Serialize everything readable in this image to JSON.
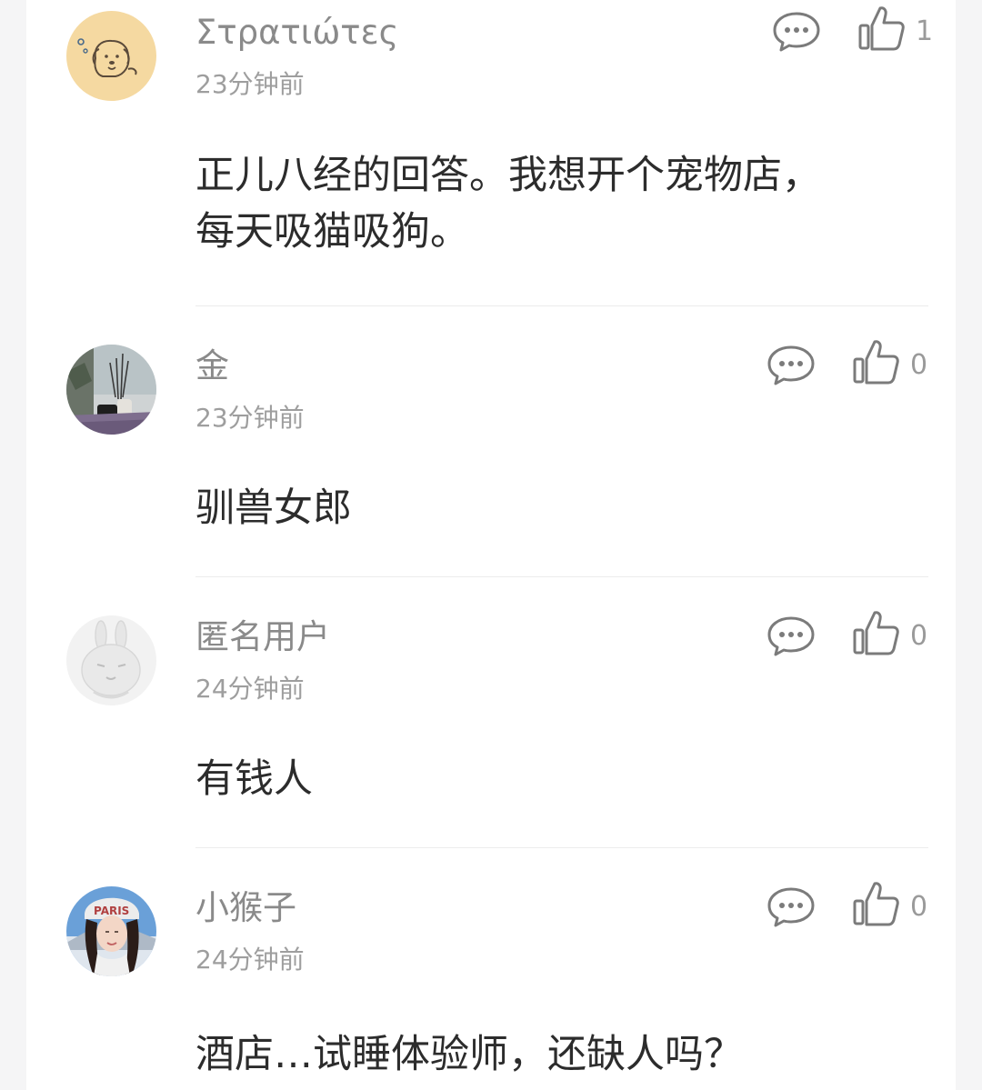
{
  "comments": [
    {
      "username": "Στρατιώτες",
      "time": "23分钟前",
      "likes": "1",
      "content_lines": [
        "正儿八经的回答。我想开个宠物店，",
        "每天吸猫吸狗。"
      ],
      "avatar_icon": "dog-cartoon-avatar"
    },
    {
      "username": "金",
      "time": "23分钟前",
      "likes": "0",
      "content_lines": [
        "驯兽女郎"
      ],
      "avatar_icon": "winter-window-photo-avatar"
    },
    {
      "username": "匿名用户",
      "time": "24分钟前",
      "likes": "0",
      "content_lines": [
        "有钱人"
      ],
      "avatar_icon": "anonymous-rabbit-avatar"
    },
    {
      "username": "小猴子",
      "time": "24分钟前",
      "likes": "0",
      "content_lines": [
        "酒店…试睡体验师，还缺人吗？"
      ],
      "avatar_icon": "girl-photo-avatar"
    }
  ],
  "colors": {
    "username": "#8a8a8a",
    "content": "#2c2c2c",
    "icon": "#7b7b7b",
    "divider": "#ececec"
  }
}
